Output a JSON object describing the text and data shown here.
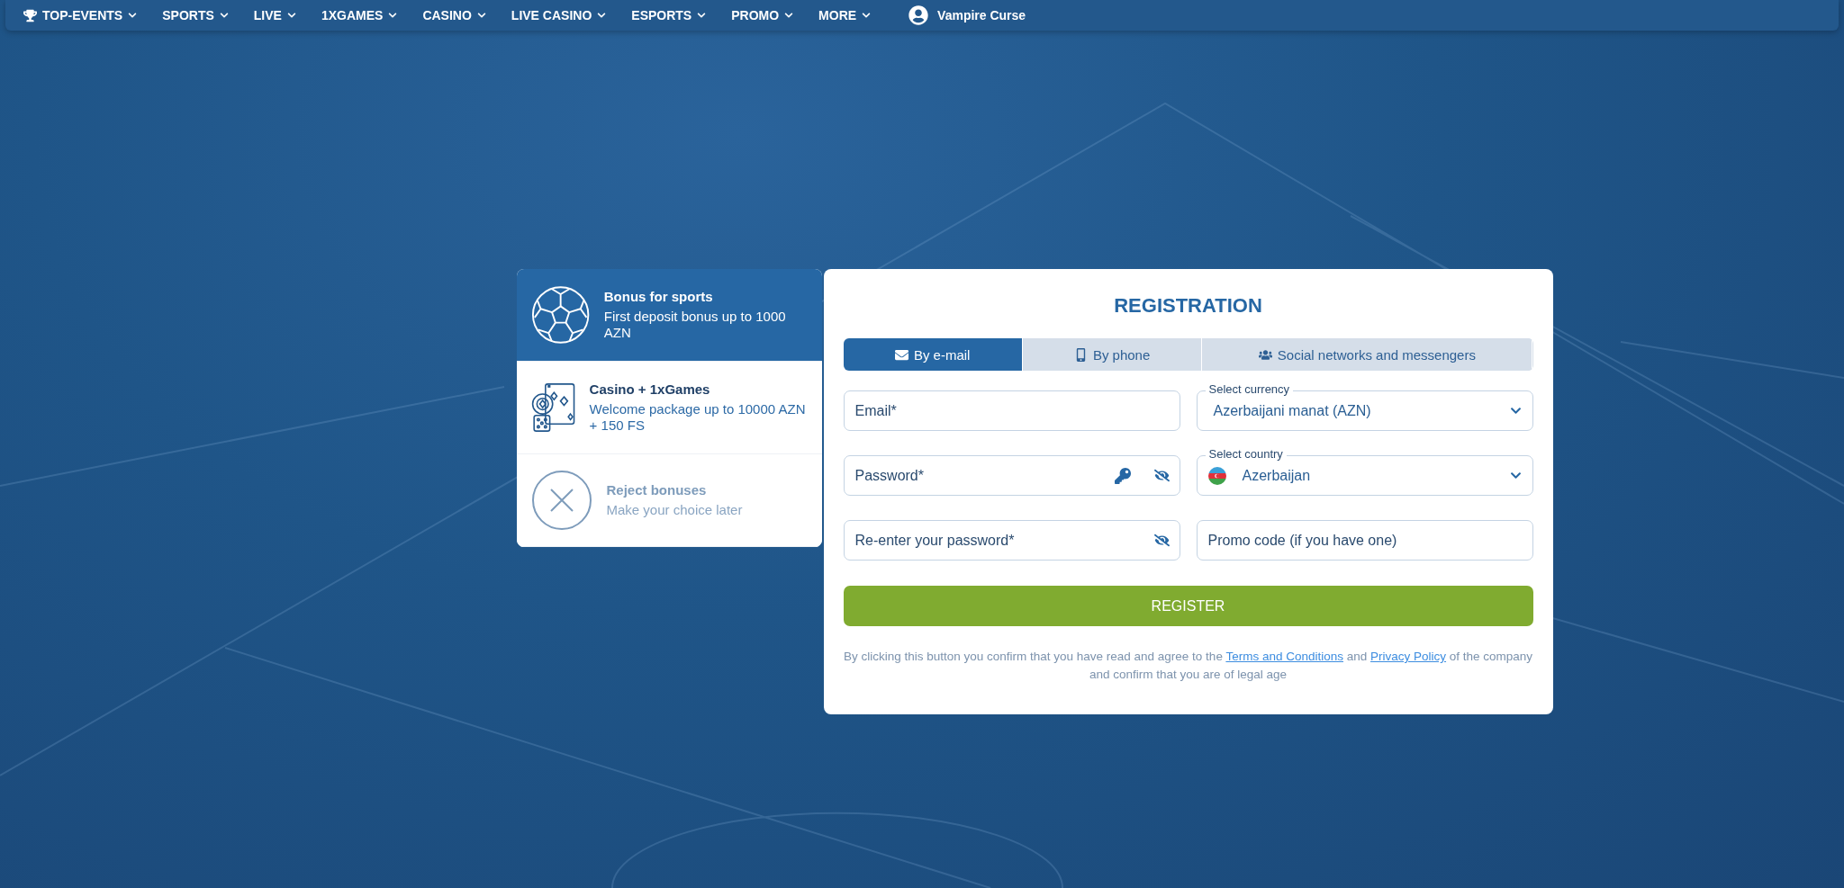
{
  "nav": {
    "items": [
      {
        "label": "TOP-EVENTS",
        "kind": "trophy"
      },
      {
        "label": "SPORTS",
        "kind": "plain"
      },
      {
        "label": "LIVE",
        "kind": "plain"
      },
      {
        "label": "1XGAMES",
        "kind": "plain"
      },
      {
        "label": "CASINO",
        "kind": "plain"
      },
      {
        "label": "LIVE CASINO",
        "kind": "plain"
      },
      {
        "label": "ESPORTS",
        "kind": "plain"
      },
      {
        "label": "PROMO",
        "kind": "plain"
      },
      {
        "label": "MORE",
        "kind": "plain"
      }
    ],
    "featured": {
      "label": "Vampire Curse"
    }
  },
  "bonuses": [
    {
      "kind": "sports",
      "title": "Bonus for sports",
      "description": "First deposit bonus up to 1000 AZN",
      "selected": true
    },
    {
      "kind": "casino",
      "title": "Casino + 1xGames",
      "description": "Welcome package up to 10000 AZN + 150 FS",
      "selected": false
    },
    {
      "kind": "reject",
      "title": "Reject bonuses",
      "description": "Make your choice later",
      "selected": false
    }
  ],
  "registration": {
    "title": "REGISTRATION",
    "tabs": [
      {
        "kind": "email",
        "label": "By e-mail",
        "selected": true
      },
      {
        "kind": "phone",
        "label": "By phone",
        "selected": false
      },
      {
        "kind": "social",
        "label": "Social networks and messengers",
        "selected": false
      }
    ],
    "fields": [
      {
        "kind": "text",
        "placeholder": "Email*"
      },
      {
        "kind": "password",
        "placeholder": "Password*"
      },
      {
        "kind": "repeat",
        "placeholder": "Re-enter your password*"
      },
      {
        "kind": "select",
        "label": "Select currency",
        "value": "Azerbaijani manat (AZN)"
      },
      {
        "kind": "country",
        "label": "Select country",
        "value": "Azerbaijan"
      },
      {
        "kind": "text",
        "placeholder": "Promo code (if you have one)"
      }
    ],
    "submit": "REGISTER",
    "terms": [
      {
        "kind": "text",
        "text": "By clicking this button you confirm that you have read and agree to the "
      },
      {
        "kind": "link",
        "text": "Terms and Conditions"
      },
      {
        "kind": "text",
        "text": " and "
      },
      {
        "kind": "link",
        "text": "Privacy Policy"
      },
      {
        "kind": "text",
        "text": " of the company and confirm that you are of legal age"
      }
    ]
  }
}
